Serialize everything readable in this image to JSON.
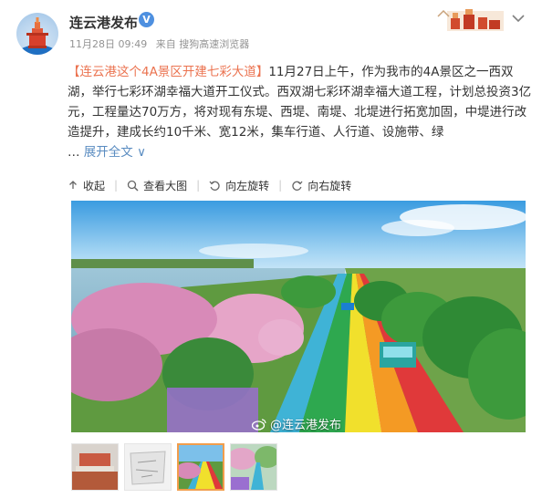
{
  "post": {
    "username": "连云港发布",
    "verified_badge": "V",
    "date": "11月28日 09:49",
    "source": "来自 搜狗高速浏览器",
    "text": {
      "lead_link": "【连云港这个4A景区开建七彩大道】",
      "body": "11月27日上午，作为我市的4A景区之一西双湖，举行七彩环湖幸福大道开工仪式。西双湖七彩环湖幸福大道工程，计划总投资3亿元，工程量达70万方，将对现有东堤、西堤、南堤、北堤进行拓宽加固，中堤进行改造提升，建成长约10千米、宽12米，集车行道、人行道、设施带、绿",
      "ellipsis": "…",
      "expand_label": "展开全文",
      "expand_chevron": "∨"
    }
  },
  "toolbar": {
    "collapse": "收起",
    "view_large": "查看大图",
    "rotate_left": "向左旋转",
    "rotate_right": "向右旋转",
    "separator": "|"
  },
  "image": {
    "watermark": "@连云港发布"
  },
  "thumbnails": [
    "thumb-1",
    "thumb-2",
    "thumb-3",
    "thumb-4"
  ],
  "icons": [
    "avatar-logo-icon",
    "chevron-down-icon",
    "collapse-icon",
    "zoom-icon",
    "rotate-left-icon",
    "rotate-right-icon",
    "weibo-icon"
  ],
  "colors": {
    "link": "#eb7350",
    "expand": "#5a8cc1",
    "meta": "#939393",
    "verified": "#4e90e0",
    "active_thumb": "#f29d4b"
  }
}
